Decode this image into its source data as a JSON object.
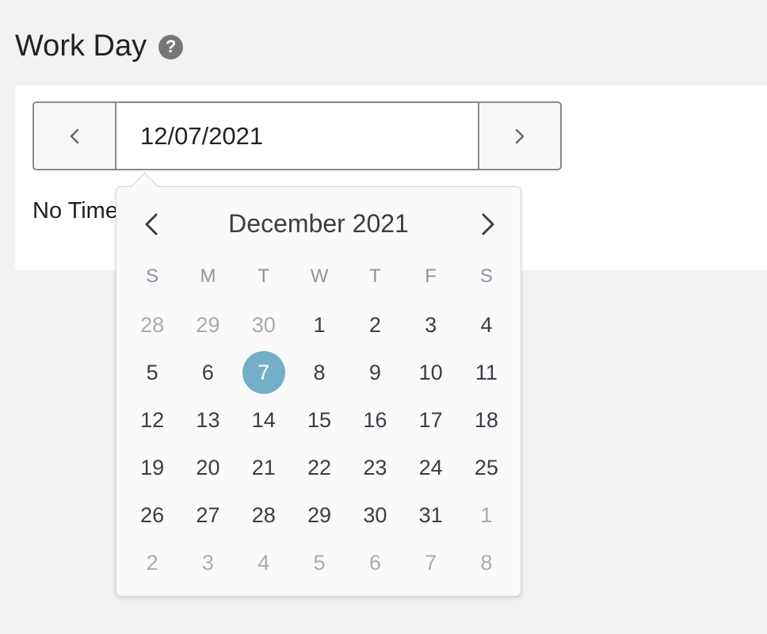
{
  "page": {
    "title": "Work Day",
    "help_icon": "question-circle-icon"
  },
  "date_nav": {
    "prev_icon": "chevron-left-icon",
    "next_icon": "chevron-right-icon",
    "value": "12/07/2021"
  },
  "no_time_text": "No Time",
  "datepicker": {
    "month_title": "December 2021",
    "weekdays": [
      "S",
      "M",
      "T",
      "W",
      "T",
      "F",
      "S"
    ],
    "days": [
      {
        "label": "28",
        "muted": true
      },
      {
        "label": "29",
        "muted": true
      },
      {
        "label": "30",
        "muted": true
      },
      {
        "label": "1"
      },
      {
        "label": "2"
      },
      {
        "label": "3"
      },
      {
        "label": "4"
      },
      {
        "label": "5"
      },
      {
        "label": "6"
      },
      {
        "label": "7",
        "selected": true
      },
      {
        "label": "8"
      },
      {
        "label": "9"
      },
      {
        "label": "10"
      },
      {
        "label": "11"
      },
      {
        "label": "12"
      },
      {
        "label": "13"
      },
      {
        "label": "14"
      },
      {
        "label": "15"
      },
      {
        "label": "16"
      },
      {
        "label": "17"
      },
      {
        "label": "18"
      },
      {
        "label": "19"
      },
      {
        "label": "20"
      },
      {
        "label": "21"
      },
      {
        "label": "22"
      },
      {
        "label": "23"
      },
      {
        "label": "24"
      },
      {
        "label": "25"
      },
      {
        "label": "26"
      },
      {
        "label": "27"
      },
      {
        "label": "28"
      },
      {
        "label": "29"
      },
      {
        "label": "30"
      },
      {
        "label": "31"
      },
      {
        "label": "1",
        "muted": true
      },
      {
        "label": "2",
        "muted": true
      },
      {
        "label": "3",
        "muted": true
      },
      {
        "label": "4",
        "muted": true
      },
      {
        "label": "5",
        "muted": true
      },
      {
        "label": "6",
        "muted": true
      },
      {
        "label": "7",
        "muted": true
      },
      {
        "label": "8",
        "muted": true
      }
    ],
    "selected_color": "#75aec8"
  }
}
